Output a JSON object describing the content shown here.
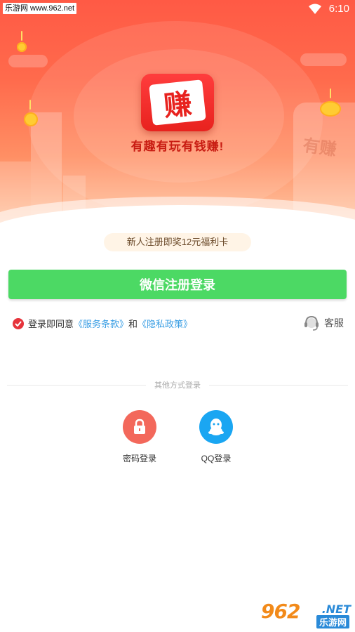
{
  "status_bar": {
    "watermark": "乐游网 www.962.net",
    "time": "6:10",
    "icons": [
      "wifi-icon",
      "signal-icon"
    ]
  },
  "hero": {
    "logo_char": "赚",
    "slogan": "有趣有玩有钱赚!",
    "building_sign": "有赚"
  },
  "promo": {
    "text": "新人注册即奖12元福利卡"
  },
  "wechat_button": {
    "label": "微信注册登录"
  },
  "agreement": {
    "prefix": "登录即同意",
    "terms_link": "《服务条款》",
    "conjunction": "和",
    "privacy_link": "《隐私政策》"
  },
  "customer_service": {
    "label": "客服"
  },
  "other_login": {
    "divider_text": "其他方式登录",
    "methods": [
      {
        "label": "密码登录",
        "icon": "lock-icon"
      },
      {
        "label": "QQ登录",
        "icon": "qq-icon"
      }
    ]
  },
  "watermark_br": {
    "number": "962",
    "domain": ".NET",
    "brand": "乐游网"
  },
  "colors": {
    "hero_top": "#ff5a45",
    "wechat_green": "#4cd964",
    "link_blue": "#3a9ee4",
    "check_red": "#e6343c",
    "pw_red": "#f3685b",
    "qq_blue": "#1aa6f2"
  }
}
